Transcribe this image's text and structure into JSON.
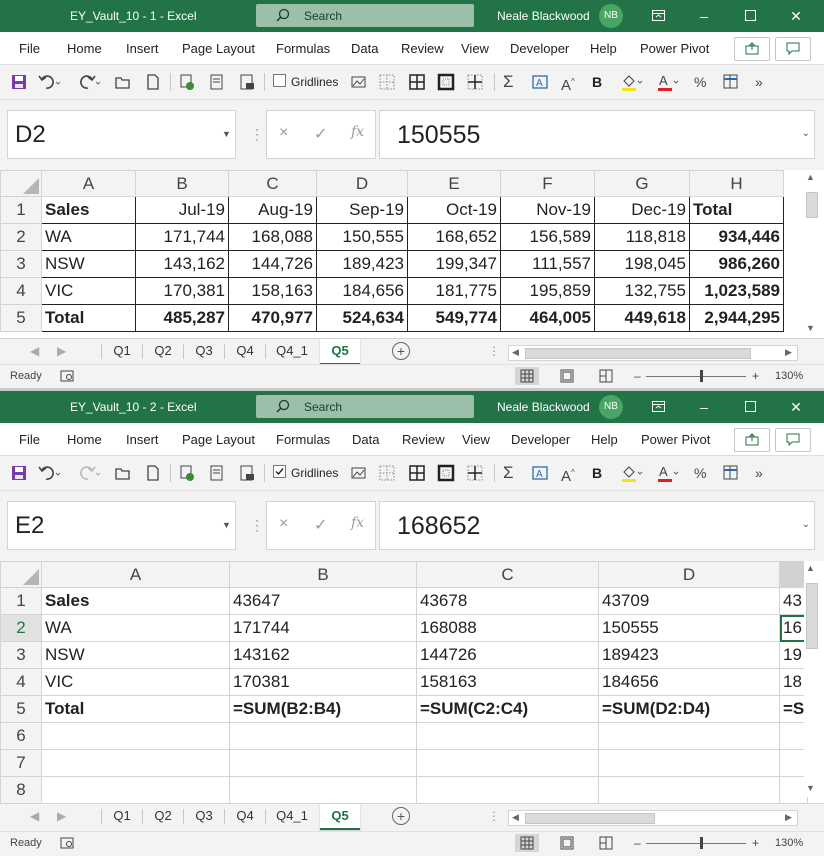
{
  "window1": {
    "title": "EY_Vault_10  -  1  -  Excel",
    "search_placeholder": "Search",
    "user_name": "Neale Blackwood",
    "user_initials": "NB",
    "name_box": "D2",
    "formula_value": "150555",
    "gridlines_label": "Gridlines",
    "gridlines_checked": false,
    "col_headers": [
      "A",
      "B",
      "C",
      "D",
      "E",
      "F",
      "G",
      "H"
    ],
    "row_headers": [
      "1",
      "2",
      "3",
      "4",
      "5"
    ],
    "rows": [
      [
        "Sales",
        "Jul-19",
        "Aug-19",
        "Sep-19",
        "Oct-19",
        "Nov-19",
        "Dec-19",
        "Total"
      ],
      [
        "WA",
        "171,744",
        "168,088",
        "150,555",
        "168,652",
        "156,589",
        "118,818",
        "934,446"
      ],
      [
        "NSW",
        "143,162",
        "144,726",
        "189,423",
        "199,347",
        "111,557",
        "198,045",
        "986,260"
      ],
      [
        "VIC",
        "170,381",
        "158,163",
        "184,656",
        "181,775",
        "195,859",
        "132,755",
        "1,023,589"
      ],
      [
        "Total",
        "485,287",
        "470,977",
        "524,634",
        "549,774",
        "464,005",
        "449,618",
        "2,944,295"
      ]
    ],
    "sheet_tabs": [
      "Q1",
      "Q2",
      "Q3",
      "Q4",
      "Q4_1",
      "Q5"
    ],
    "active_sheet": "Q5",
    "status_text": "Ready",
    "zoom": "130%"
  },
  "window2": {
    "title": "EY_Vault_10  -  2  -  Excel",
    "search_placeholder": "Search",
    "user_name": "Neale Blackwood",
    "user_initials": "NB",
    "name_box": "E2",
    "formula_value": "168652",
    "gridlines_label": "Gridlines",
    "gridlines_checked": true,
    "col_headers": [
      "A",
      "B",
      "C",
      "D",
      ""
    ],
    "row_headers": [
      "1",
      "2",
      "3",
      "4",
      "5",
      "6",
      "7",
      "8"
    ],
    "rows": [
      [
        "Sales",
        "43647",
        "43678",
        "43709",
        "43"
      ],
      [
        "WA",
        "171744",
        "168088",
        "150555",
        "16"
      ],
      [
        "NSW",
        "143162",
        "144726",
        "189423",
        "19"
      ],
      [
        "VIC",
        "170381",
        "158163",
        "184656",
        "18"
      ],
      [
        "Total",
        "=SUM(B2:B4)",
        "=SUM(C2:C4)",
        "=SUM(D2:D4)",
        "=S"
      ],
      [
        "",
        "",
        "",
        "",
        ""
      ],
      [
        "",
        "",
        "",
        "",
        ""
      ],
      [
        "",
        "",
        "",
        "",
        ""
      ]
    ],
    "sheet_tabs": [
      "Q1",
      "Q2",
      "Q3",
      "Q4",
      "Q4_1",
      "Q5"
    ],
    "active_sheet": "Q5",
    "status_text": "Ready",
    "zoom": "130%"
  },
  "ribbon_tabs": [
    "File",
    "Home",
    "Insert",
    "Page Layout",
    "Formulas",
    "Data",
    "Review",
    "View",
    "Developer",
    "Help",
    "Power Pivot"
  ],
  "formula_bar": {
    "cancel": "×",
    "enter": "✓",
    "fx": "fx"
  },
  "icons": [
    "save-icon",
    "undo-icon",
    "redo-icon",
    "open-icon",
    "new-icon",
    "print-icon",
    "sum-icon",
    "bold-icon",
    "font-color-icon",
    "fill-color-icon"
  ],
  "colors": {
    "excel_green": "#227447",
    "active_tab": "#217346"
  }
}
